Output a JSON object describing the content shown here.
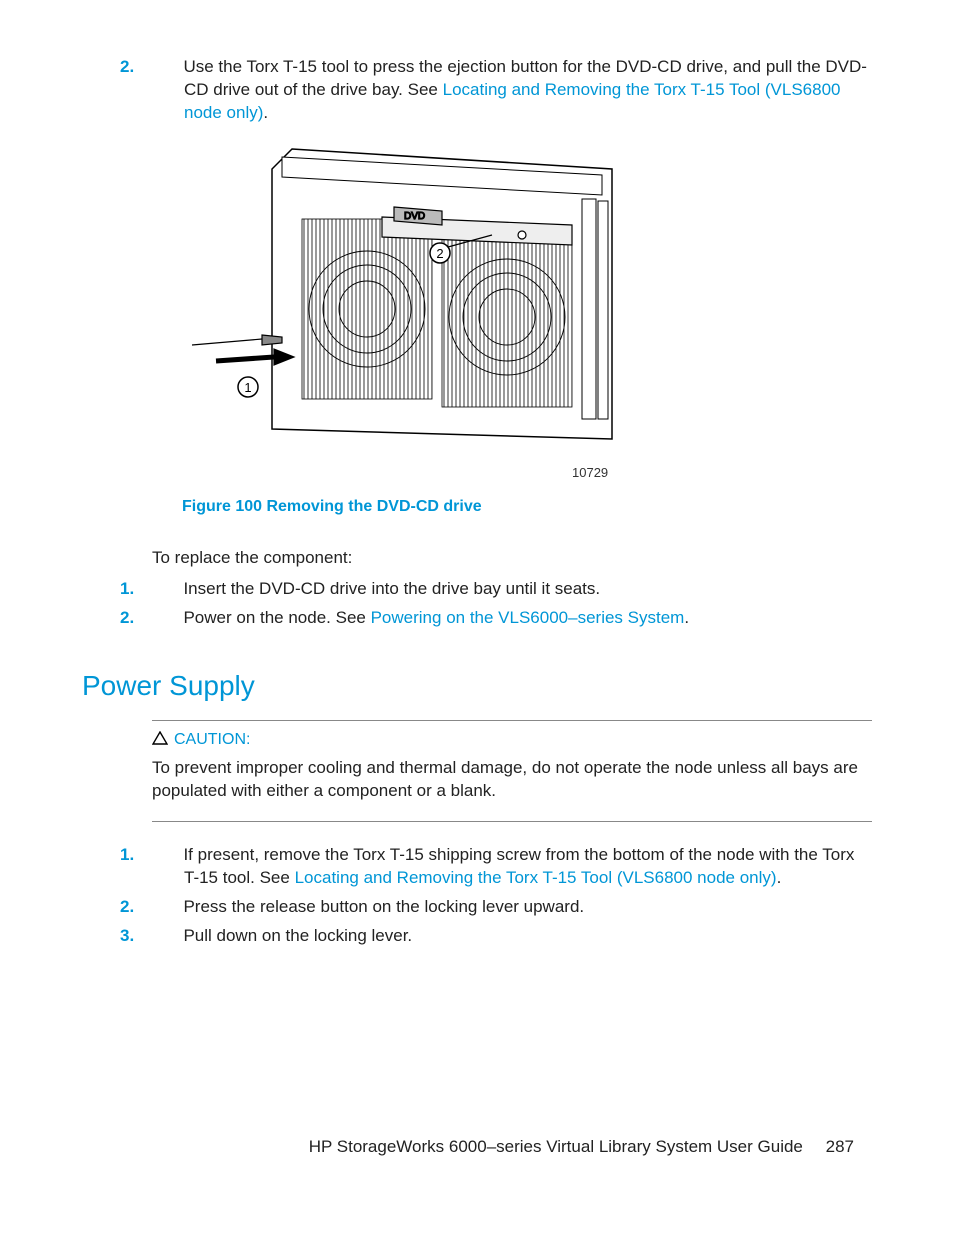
{
  "top_steps": [
    {
      "num": "2.",
      "segments": [
        {
          "t": "Use the Torx T-15 tool to press the ejection button for the DVD-CD drive, and pull the DVD-CD drive out of the drive bay. See "
        },
        {
          "t": "Locating and Removing the Torx T-15 Tool (VLS6800 node only)",
          "link": true
        },
        {
          "t": "."
        }
      ]
    }
  ],
  "figure_id": "10729",
  "figure_caption": "Figure 100 Removing the DVD-CD drive",
  "replace_intro": "To replace the component:",
  "replace_steps": [
    {
      "num": "1.",
      "segments": [
        {
          "t": "Insert the DVD-CD drive into the drive bay until it seats."
        }
      ]
    },
    {
      "num": "2.",
      "segments": [
        {
          "t": "Power on the node. See "
        },
        {
          "t": "Powering on the VLS6000–series System",
          "link": true
        },
        {
          "t": "."
        }
      ]
    }
  ],
  "section_heading": "Power Supply",
  "caution_label": "CAUTION:",
  "caution_body": "To prevent improper cooling and thermal damage, do not operate the node unless all bays are populated with either a component or a blank.",
  "ps_steps": [
    {
      "num": "1.",
      "segments": [
        {
          "t": "If present, remove the Torx T-15 shipping screw from the bottom of the node with the Torx T-15 tool. See "
        },
        {
          "t": "Locating and Removing the Torx T-15 Tool (VLS6800 node only)",
          "link": true
        },
        {
          "t": "."
        }
      ]
    },
    {
      "num": "2.",
      "segments": [
        {
          "t": "Press the release button on the locking lever upward."
        }
      ]
    },
    {
      "num": "3.",
      "segments": [
        {
          "t": "Pull down on the locking lever."
        }
      ]
    }
  ],
  "footer_title": "HP StorageWorks 6000–series Virtual Library System User Guide",
  "footer_page": "287"
}
